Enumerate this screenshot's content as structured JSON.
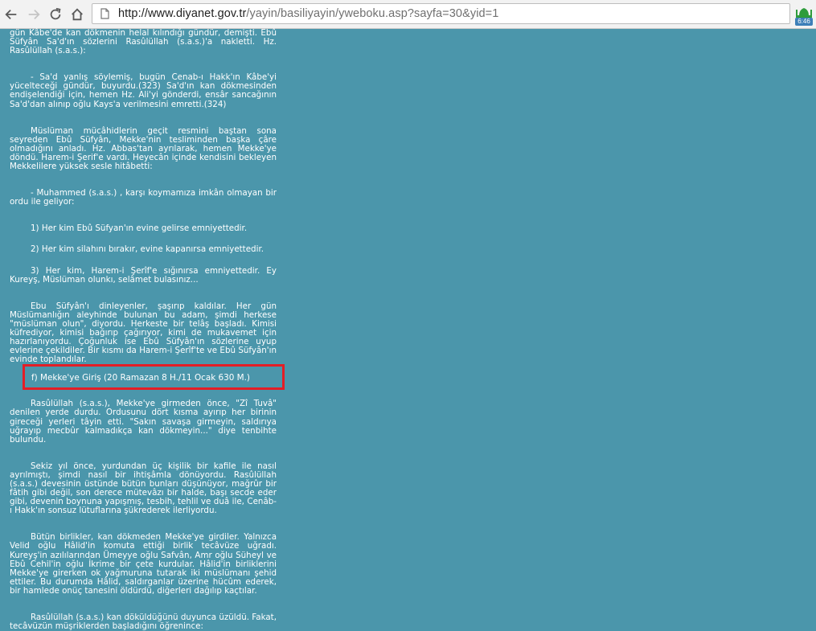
{
  "browser": {
    "url_host": "http://www.diyanet.gov.tr",
    "url_path": "/yayin/basiliyayin/yweboku.asp?sayfa=30&yid=1",
    "extension_badge": "6:46"
  },
  "article": {
    "paragraphs": [
      "gün Kâbe'de kan dökmenin helal kılındığı gündür, demişti. Ebû Süfyân Sa'd'ın sözlerini Rasûlüllah (s.a.s.)'a nakletti. Hz. Rasûlüllah (s.a.s.):",
      "- Sa'd yanlış söylemiş, bugün Cenab-ı Hakk'ın Kâbe'yi yücelteceği gündür, buyurdu.(323) Sa'd'ın kan dökmesinden endişelendiği için, hemen Hz. Ali'yi gönderdi, ensâr sancağının Sa'd'dan alınıp oğlu Kays'a verilmesini emretti.(324)",
      "Müslüman mücâhidlerin geçit resmini baştan sona seyreden Ebû Süfyân, Mekke'nin tesliminden başka çâre olmadığını anladı. Hz. Abbas'tan ayrılarak, hemen Mekke'ye döndü. Harem-i Şerif'e vardı. Heyecân içinde kendisini bekleyen Mekkelilere yüksek sesle hitâbetti:",
      "- Muhammed (s.a.s.) , karşı koymamıza imkân olmayan bir ordu ile geliyor:",
      "1) Her kim Ebû Süfyan'ın evine gelirse emniyettedir.",
      "2) Her kim silahını bırakır, evine kapanırsa emniyettedir.",
      "3) Her kim, Harem-i Şerîf'e sığınırsa emniyettedir. Ey Kureyş, Müslüman olunkı, selâmet bulasınız...",
      "Ebu Süfyân'ı dinleyenler, şaşırıp kaldılar. Her gün Müslümanlığın aleyhinde bulunan bu adam, şimdi herkese \"müslüman olun\", diyordu. Herkeste bir telâş başladı. Kimisi küfrediyor, kimisi bağırıp çağırıyor, kimi de mukavemet için hazırlanıyordu. Çoğunluk ise Ebû Süfyân'ın sözlerine uyup evlerine çekildiler. Bir kısmı da Harem-i Şerîf'te ve Ebû Süfyân'ın evinde toplandılar.",
      "Rasûlüllah (s.a.s.), Mekke'ye girmeden önce, \"Zî Tuvâ\" denilen yerde durdu. Ordusunu dört kısma ayırıp her birinin gireceği yerleri tâyin etti. \"Sakın savaşa girmeyin, saldırıya uğrayıp mecbûr kalmadıkça kan dökmeyin...\" diye tenbihte bulundu.",
      "Sekiz yıl önce, yurdundan üç kişilik bir kafile ile nasıl ayrılmıştı, şimdi nasıl bir ihtişâmla dönüyordu. Rasûlüllah (s.a.s.) devesinin üstünde bütün bunları düşünüyor, mağrûr bir fâtih gibi değil, son derece mütevâzı bir halde, başı secde eder gibi, devenin boynuna yapışmış, tesbih, tehlil ve duâ ile, Cenâb-ı Hakk'ın sonsuz lütuflarına şükrederek ilerliyordu.",
      "Bütün birlikler, kan dökmeden Mekke'ye girdiler. Yalnızca Velid oğlu Hâlid'in komuta ettiği birlik tecâvüze uğradı. Kureyş'in azılılarından Ümeyye oğlu Safvân, Amr oğlu Süheyl ve Ebû Cehil'in oğlu İkrime bir çete kurdular. Hâlid'in birliklerini Mekke'ye girerken ok yağmuruna tutarak iki müslümanı şehid ettiler. Bu durumda Hâlid, saldırganlar üzerine hücûm ederek, bir hamlede onüç tanesini öldürdü, diğerleri dağılıp kaçtılar.",
      "Rasûlüllah (s.a.s.) kan döküldüğünü duyunca üzüldü. Fakat, tecâvüzün müşriklerden başladığını öğrenince:"
    ],
    "heading": "f) Mekke'ye Giriş (20 Ramazan 8 H./11 Ocak 630 M.)"
  }
}
